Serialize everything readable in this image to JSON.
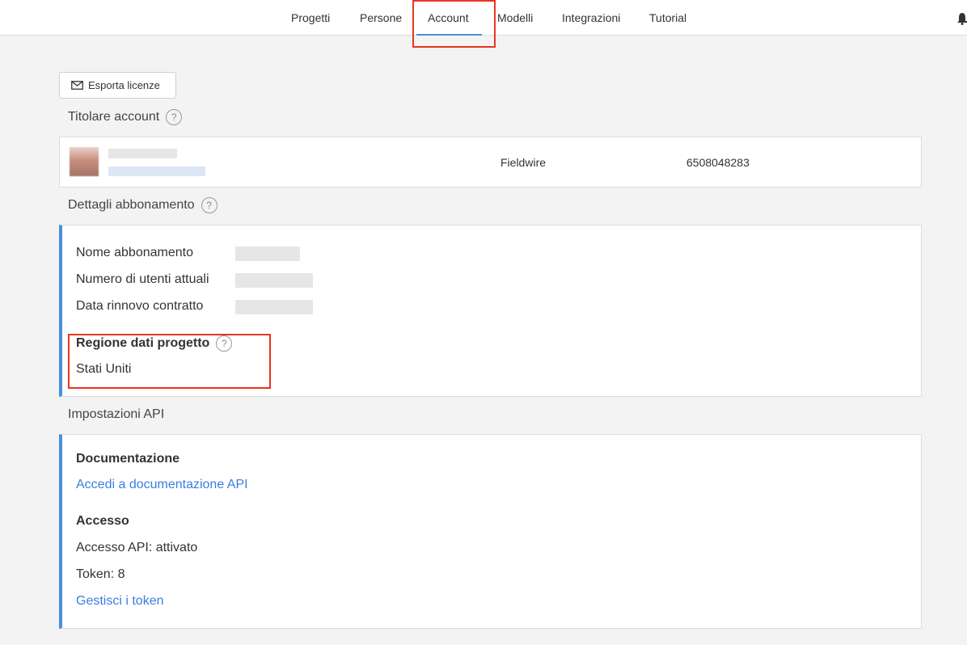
{
  "nav": {
    "tabs": [
      {
        "label": "Progetti"
      },
      {
        "label": "Persone"
      },
      {
        "label": "Account"
      },
      {
        "label": "Modelli"
      },
      {
        "label": "Integrazioni"
      },
      {
        "label": "Tutorial"
      }
    ],
    "active_tab": "Account"
  },
  "toolbar": {
    "export_label": "Esporta licenze"
  },
  "owner": {
    "section_title": "Titolare account",
    "company": "Fieldwire",
    "phone": "6508048283"
  },
  "subscription": {
    "section_title": "Dettagli abbonamento",
    "plan_label": "Nome abbonamento",
    "users_label": "Numero di utenti attuali",
    "renewal_label": "Data rinnovo contratto",
    "region_title": "Regione dati progetto",
    "region_value": "Stati Uniti"
  },
  "api": {
    "section_title": "Impostazioni API",
    "docs_title": "Documentazione",
    "docs_link": "Accedi a documentazione API",
    "access_title": "Accesso",
    "access_status": "Accesso API: attivato",
    "token_count": "Token: 8",
    "manage_tokens_link": "Gestisci i token"
  },
  "colors": {
    "accent": "#4a90d9",
    "link": "#3b7de0",
    "highlight_border": "#e8351f"
  },
  "icons": {
    "help": "question-circle-icon",
    "mail": "envelope-icon",
    "bell": "bell-icon"
  }
}
